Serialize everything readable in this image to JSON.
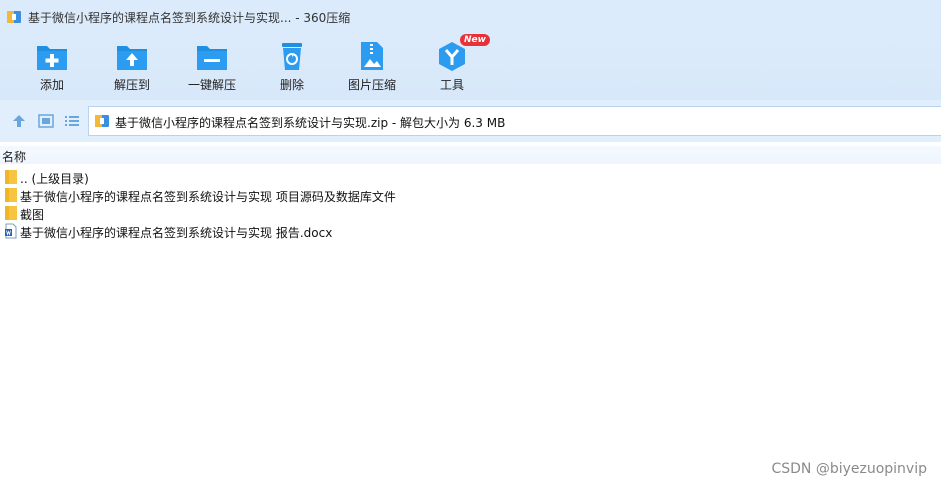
{
  "window": {
    "title": "基于微信小程序的课程点名签到系统设计与实现... - 360压缩"
  },
  "toolbar": {
    "items": [
      {
        "label": "添加",
        "icon": "add-folder-icon"
      },
      {
        "label": "解压到",
        "icon": "extract-to-icon"
      },
      {
        "label": "一键解压",
        "icon": "one-click-extract-icon"
      },
      {
        "label": "删除",
        "icon": "trash-icon"
      },
      {
        "label": "图片压缩",
        "icon": "image-compress-icon"
      },
      {
        "label": "工具",
        "icon": "tools-icon",
        "badge": "New"
      }
    ]
  },
  "navbar": {
    "path": "基于微信小程序的课程点名签到系统设计与实现.zip - 解包大小为 6.3 MB"
  },
  "filelist": {
    "column_name": "名称",
    "items": [
      {
        "name": ".. (上级目录)",
        "type": "folder"
      },
      {
        "name": "基于微信小程序的课程点名签到系统设计与实现 项目源码及数据库文件",
        "type": "folder"
      },
      {
        "name": "截图",
        "type": "folder"
      },
      {
        "name": "基于微信小程序的课程点名签到系统设计与实现 报告.docx",
        "type": "docx"
      }
    ]
  },
  "watermark": "CSDN @biyezuopinvip",
  "colors": {
    "accent": "#1e8fe1",
    "toolbar_bg": "#dcebfb",
    "folder": "#f5c542",
    "badge": "#e8323a"
  }
}
